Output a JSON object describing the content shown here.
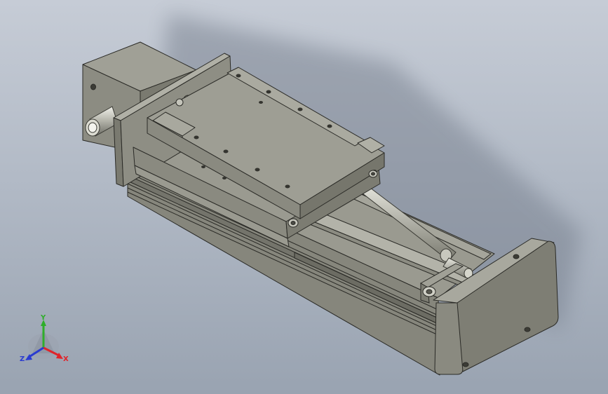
{
  "viewport": {
    "background_top": "#c6ccd6",
    "background_bottom": "#99a3b1",
    "model_color": "#8c8c82"
  },
  "triad": {
    "x_label": "X",
    "y_label": "Y",
    "z_label": "Z",
    "x_color": "#e0242a",
    "y_color": "#2fae2b",
    "z_color": "#2a3bd0"
  }
}
